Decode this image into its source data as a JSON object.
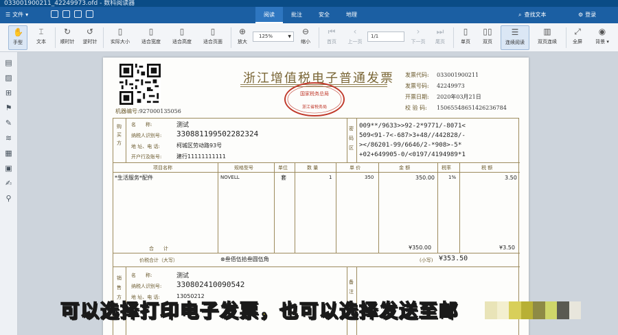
{
  "window": {
    "title": "033001900211_42249973.ofd - 数科阅读器"
  },
  "menubar": {
    "file_label": "文件",
    "tabs": [
      "阅读",
      "批注",
      "安全",
      "地理"
    ],
    "active_tab": "阅读",
    "search_label": "查找文本",
    "login_label": "登录"
  },
  "toolbar": {
    "hand": "手型",
    "text": "文本",
    "rotate_cw": "顺时针",
    "rotate_ccw": "逆时针",
    "actual_size": "实际大小",
    "fit_width": "适合宽度",
    "fit_height": "适合高度",
    "fit_page": "适合页面",
    "zoom_in": "放大",
    "zoom_value": "125%",
    "zoom_out": "缩小",
    "first_page": "首页",
    "prev_page": "上一页",
    "page_value": "1/1",
    "next_page": "下一页",
    "last_page": "尾页",
    "single_page": "单页",
    "double_page": "双页",
    "continuous": "连续阅读",
    "double_continuous": "双页连续",
    "fullscreen": "全屏",
    "background": "背景"
  },
  "invoice": {
    "title": "浙江增值税电子普通发票",
    "machine_label": "机器编号:",
    "machine_no": "927000135056",
    "seal_top": "国家税务总局",
    "seal_mid": "浙江省税务局",
    "code_label": "发票代码:",
    "code": "033001900211",
    "number_label": "发票号码:",
    "number": "42249973",
    "date_label": "开票日期:",
    "date": "2020年03月21日",
    "check_label": "校 验 码:",
    "check": "15065548651426236784",
    "buyer_side": "购买方",
    "name_label": "名　　称:",
    "buyer_name": "测试",
    "taxid_label": "纳税人识别号:",
    "buyer_taxid": "330881199502282324",
    "addr_label": "地 址、电 话:",
    "buyer_addr": "柯城区劳动路93号",
    "bank_label": "开户行及账号:",
    "buyer_bank": "建行11111111111",
    "cipher_label": "密码区",
    "cipher": [
      "009**/9633>>92-2*9771/-8071<",
      "509<91-7<-687>3+48//442828/-",
      "></86201-99/6646/2-*908>-5*",
      "+02+649905-0/<0197/4194989*1"
    ],
    "col_item": "项目名称",
    "col_spec": "规格型号",
    "col_unit": "单位",
    "col_qty": "数 量",
    "col_price": "单 价",
    "col_amount": "金 额",
    "col_rate": "税率",
    "col_tax": "税 额",
    "item": "*生活服务*配件",
    "spec": "NOVELL",
    "unit": "套",
    "qty": "1",
    "price": "350",
    "amount": "350.00",
    "rate": "1%",
    "tax": "3.50",
    "total_label": "合　　计",
    "total_amount": "¥350.00",
    "total_tax": "¥3.50",
    "grand_label": "价税合计（大写）",
    "grand_upper": "⊗叁佰伍拾叁圆伍角",
    "grand_small_label": "(小写)",
    "grand_small": "¥353.50",
    "seller_side": "销售方",
    "seller_name": "测试",
    "seller_taxid": "330802410090542",
    "seller_tel": "13050212",
    "remark_label": "备注"
  },
  "subtitle": "可以选择打印电子发票，也可以选择发送至邮",
  "colors": {
    "menubar": "#1b5fa3",
    "titlebar": "#0a4c86",
    "invoice_ink": "#6b5a2e",
    "seal": "#c0392b",
    "subtitle": "#f6e83a"
  }
}
